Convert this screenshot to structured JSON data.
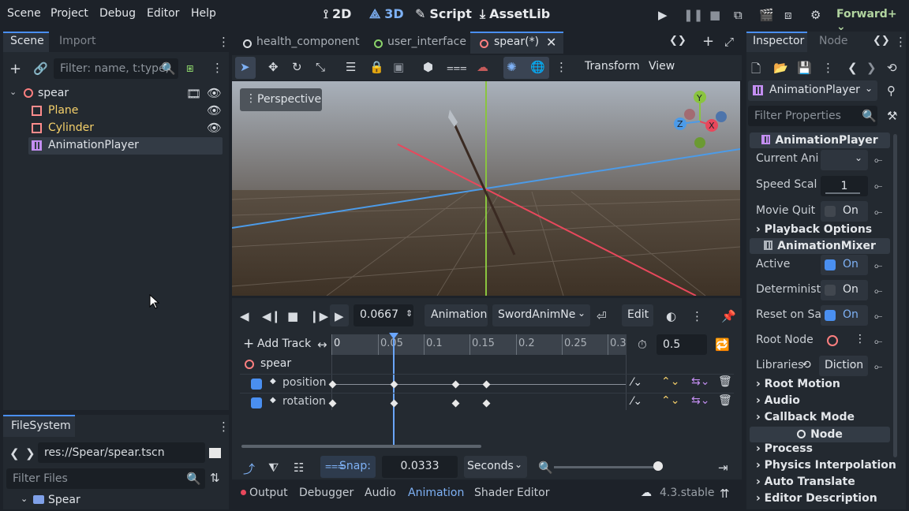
{
  "menu": {
    "scene": "Scene",
    "project": "Project",
    "debug": "Debug",
    "editor": "Editor",
    "help": "Help"
  },
  "workspaces": {
    "w2d": "2D",
    "w3d": "3D",
    "script": "Script",
    "assetlib": "AssetLib"
  },
  "renderer": "Forward+",
  "scene_dock": {
    "tab_scene": "Scene",
    "tab_import": "Import",
    "filter_placeholder": "Filter: name, t:type,",
    "nodes": [
      {
        "label": "spear"
      },
      {
        "label": "Plane"
      },
      {
        "label": "Cylinder"
      },
      {
        "label": "AnimationPlayer"
      }
    ]
  },
  "editor_tabs": [
    {
      "label": "health_component"
    },
    {
      "label": "user_interface"
    },
    {
      "label": "spear(*)"
    }
  ],
  "viewport_toolbar": {
    "transform": "Transform",
    "view": "View",
    "perspective": "Perspective"
  },
  "gizmo": {
    "y": "Y",
    "x": "X",
    "z": "Z"
  },
  "animation": {
    "time": "0.0667",
    "animation_btn": "Animation",
    "current": "SwordAnimNe",
    "edit": "Edit",
    "add_track": "Add Track",
    "length": "0.5",
    "ruler": [
      "0",
      "0.05",
      "0.1",
      "0.15",
      "0.2",
      "0.25",
      "0.3"
    ],
    "root_track": "spear",
    "tracks": [
      {
        "label": "position"
      },
      {
        "label": "rotation"
      }
    ],
    "snap_label": "Snap:",
    "snap_value": "0.0333",
    "snap_unit": "Seconds"
  },
  "filesystem": {
    "tab": "FileSystem",
    "path": "res://Spear/spear.tscn",
    "filter_placeholder": "Filter Files",
    "folder": "Spear"
  },
  "bottom_tabs": {
    "output": "Output",
    "debugger": "Debugger",
    "audio": "Audio",
    "animation": "Animation",
    "shader": "Shader Editor",
    "version": "4.3.stable"
  },
  "inspector": {
    "tab_inspector": "Inspector",
    "tab_node": "Node",
    "node_type": "AnimationPlayer",
    "filter_placeholder": "Filter Properties",
    "section_player": "AnimationPlayer",
    "current_anim": "Current Ani",
    "speed_scale": "Speed Scal",
    "speed_value": "1",
    "movie_quit": "Movie Quit",
    "on": "On",
    "playback_options": "Playback Options",
    "section_mixer": "AnimationMixer",
    "active": "Active",
    "deterministic": "Determinist",
    "reset_on_save": "Reset on Sa",
    "root_node": "Root Node",
    "libraries": "Libraries",
    "libraries_value": "Diction",
    "root_motion": "Root Motion",
    "audio": "Audio",
    "callback_mode": "Callback Mode",
    "section_node": "Node",
    "process": "Process",
    "physics_interp": "Physics Interpolation",
    "auto_translate": "Auto Translate",
    "editor_desc": "Editor Description"
  },
  "colors": {
    "accent": "#4a8ff0",
    "node3d": "#fc7f7f",
    "mesh": "#ff8c8c",
    "anim": "#c38ef1",
    "folder": "#7fa0e8",
    "xaxis": "#e8485c",
    "zaxis": "#4c9be8",
    "yaxis": "#8ac43f"
  }
}
